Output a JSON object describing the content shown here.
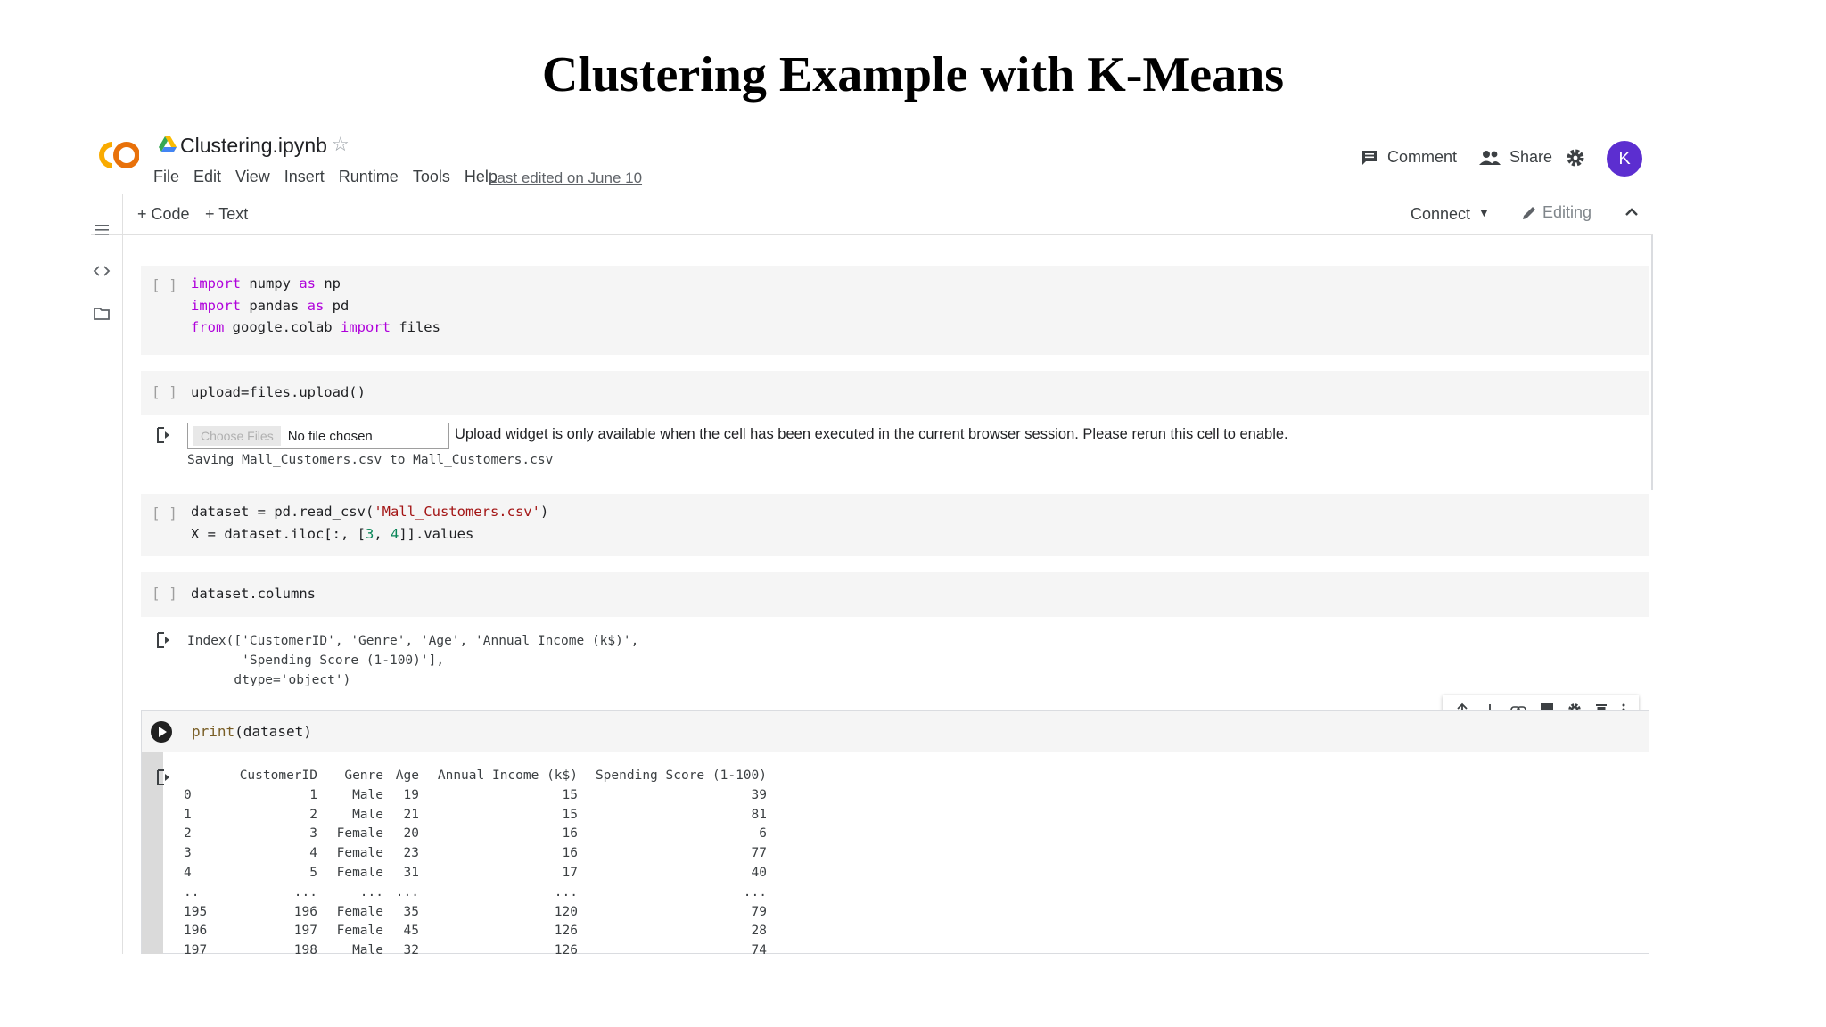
{
  "slide": {
    "title": "Clustering Example with K-Means"
  },
  "header": {
    "logo_text": "CO",
    "notebook_title": "Clustering.ipynb",
    "menu": [
      "File",
      "Edit",
      "View",
      "Insert",
      "Runtime",
      "Tools",
      "Help"
    ],
    "last_edited": "Last edited on June 10",
    "comment_label": "Comment",
    "share_label": "Share",
    "avatar_letter": "K"
  },
  "toolbar": {
    "add_code": "+ Code",
    "add_text": "+ Text",
    "connect": "Connect",
    "editing": "Editing"
  },
  "cells": {
    "run_indicator": "[ ]",
    "upload_output": {
      "choose_files": "Choose Files",
      "no_file": "No file chosen",
      "message": "Upload widget is only available when the cell has been executed in the current browser session. Please rerun this cell to enable.",
      "saving": "Saving Mall_Customers.csv to Mall_Customers.csv"
    },
    "columns_output": [
      "Index(['CustomerID', 'Genre', 'Age', 'Annual Income (k$)',",
      "       'Spending Score (1-100)'],",
      "      dtype='object')"
    ]
  },
  "dataframe": {
    "headers": [
      "",
      "CustomerID",
      "Genre",
      "Age",
      "Annual Income (k$)",
      "Spending Score (1-100)"
    ],
    "rows": [
      [
        "0",
        "1",
        "Male",
        "19",
        "15",
        "39"
      ],
      [
        "1",
        "2",
        "Male",
        "21",
        "15",
        "81"
      ],
      [
        "2",
        "3",
        "Female",
        "20",
        "16",
        "6"
      ],
      [
        "3",
        "4",
        "Female",
        "23",
        "16",
        "77"
      ],
      [
        "4",
        "5",
        "Female",
        "31",
        "17",
        "40"
      ],
      [
        "..",
        "...",
        "...",
        "...",
        "...",
        "..."
      ],
      [
        "195",
        "196",
        "Female",
        "35",
        "120",
        "79"
      ],
      [
        "196",
        "197",
        "Female",
        "45",
        "126",
        "28"
      ],
      [
        "197",
        "198",
        "Male",
        "32",
        "126",
        "74"
      ]
    ]
  },
  "colors": {
    "accent": "#5c2ed0",
    "cell_bg": "#f5f5f5",
    "logo_orange": "#f9ab00"
  }
}
